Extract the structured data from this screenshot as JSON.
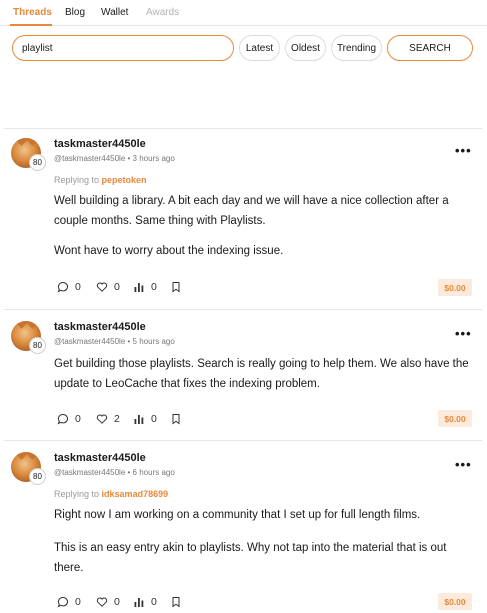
{
  "tabs": [
    {
      "label": "Threads",
      "active": true
    },
    {
      "label": "Blog",
      "active": false
    },
    {
      "label": "Wallet",
      "active": false
    },
    {
      "label": "Awards",
      "active": false,
      "disabled": true
    }
  ],
  "search": {
    "value": "playlist",
    "sort_buttons": [
      "Latest",
      "Oldest",
      "Trending"
    ],
    "submit_label": "SEARCH"
  },
  "colors": {
    "accent": "#e8893a",
    "payout_bg": "#fcebdc"
  },
  "posts": [
    {
      "username": "taskmaster4450le",
      "handle": "@taskmaster4450le",
      "separator": "•",
      "time": "3 hours ago",
      "reputation": "80",
      "replying_prefix": "Replying to",
      "replying_to": "pepetoken",
      "paragraphs": [
        "Well building a library. A bit each day and we will have a nice collection after a couple months. Same thing with Playlists.",
        "Wont have to worry about the indexing issue."
      ],
      "comments": "0",
      "likes": "0",
      "views": "0",
      "payout": "$0.00"
    },
    {
      "username": "taskmaster4450le",
      "handle": "@taskmaster4450le",
      "separator": "•",
      "time": "5 hours ago",
      "reputation": "80",
      "paragraphs": [
        "Get building those playlists. Search is really going to help them. We also have the update to LeoCache that fixes the indexing problem."
      ],
      "comments": "0",
      "likes": "2",
      "views": "0",
      "payout": "$0.00"
    },
    {
      "username": "taskmaster4450le",
      "handle": "@taskmaster4450le",
      "separator": "•",
      "time": "6 hours ago",
      "reputation": "80",
      "replying_prefix": "Replying to",
      "replying_to": "idksamad78699",
      "paragraphs": [
        "Right now I am working on a community that I set up for full length films.",
        "This is an easy entry akin to playlists. Why not tap into the material that is out there."
      ],
      "comments": "0",
      "likes": "0",
      "views": "0",
      "payout": "$0.00"
    }
  ]
}
